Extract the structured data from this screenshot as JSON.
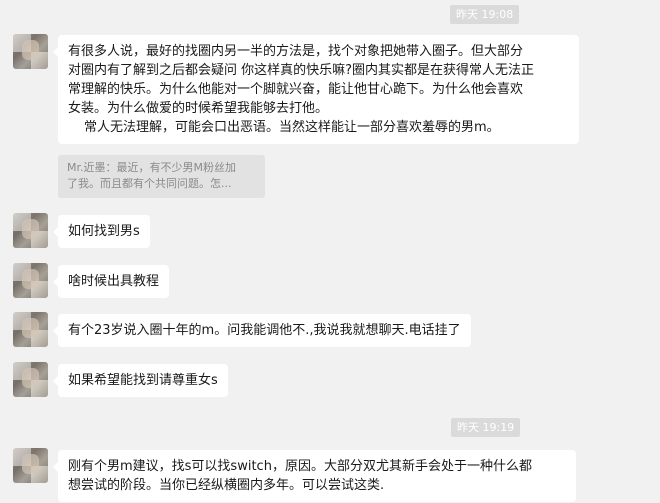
{
  "timestamps": [
    "昨天 19:08",
    "昨天 19:19"
  ],
  "messages": [
    {
      "lines": [
        "有很多人说，最好的找圈内另一半的方法是，找个对象把她带入圈子。但大部分",
        "对圈内有了解到之后都会疑问 你这样真的快乐嘛?圈内其实都是在获得常人无法正",
        "常理解的快乐。为什么他能对一个脚就兴奋，能让他甘心跪下。为什么他会喜欢",
        "女装。为什么做爱的时候希望我能够去打他。",
        "常人无法理解，可能会口出恶语。当然这样能让一部分喜欢羞辱的男m。"
      ]
    },
    {
      "quote_lines": [
        "Mr.近墨：最近，有不少男M粉丝加",
        "了我。而且都有个共同问题。怎..."
      ]
    },
    {
      "text": "如何找到男s"
    },
    {
      "text": "啥时候出具教程"
    },
    {
      "text": "有个23岁说入圈十年的m。问我能调他不.,我说我就想聊天.电话挂了"
    },
    {
      "text": "如果希望能找到请尊重女s"
    },
    {
      "lines": [
        "刚有个男m建议，找s可以找switch，原因。大部分双尤其新手会处于一种什么都",
        "想尝试的阶段。当你已经纵横圈内多年。可以尝试这类."
      ]
    }
  ]
}
